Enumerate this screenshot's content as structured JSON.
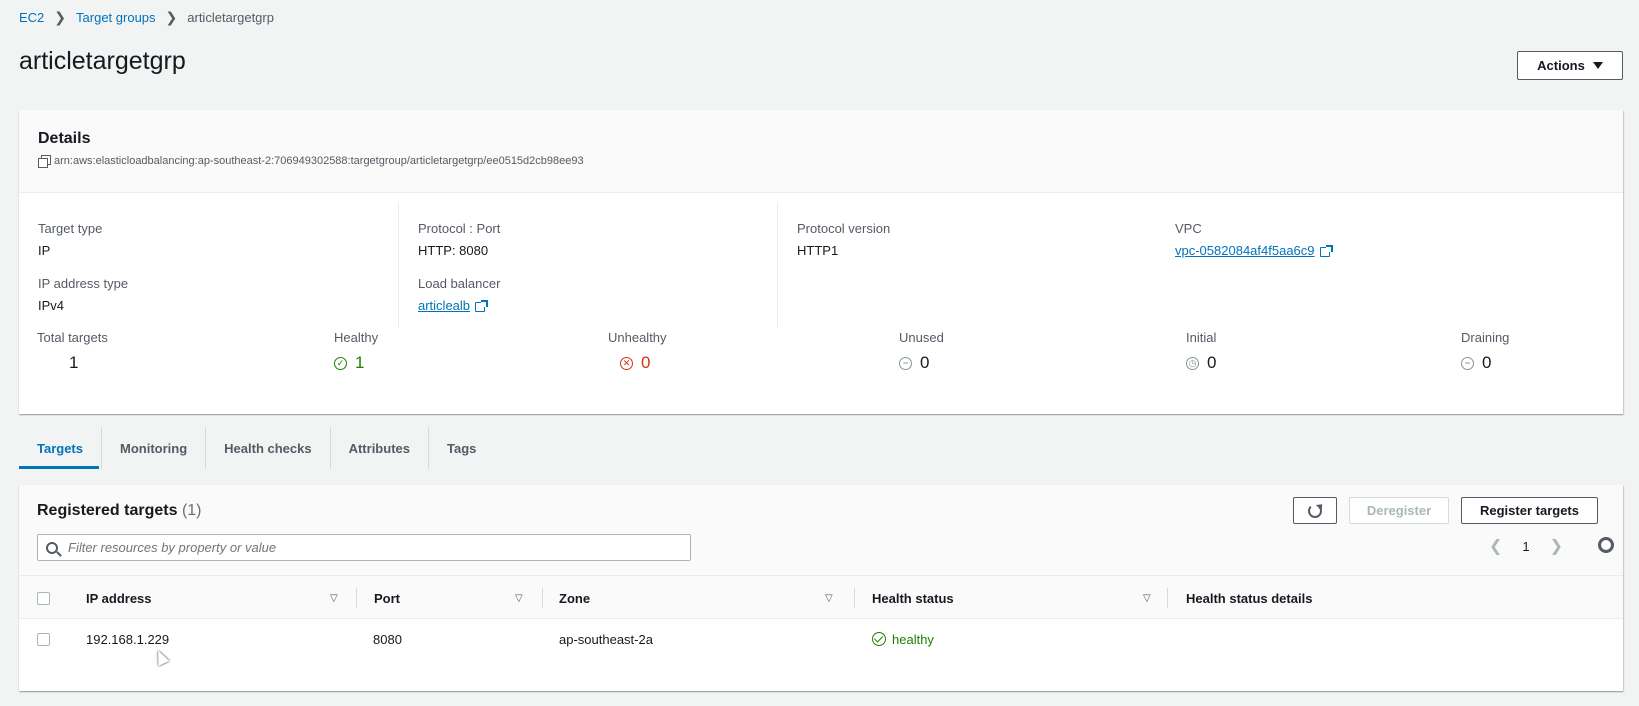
{
  "breadcrumb": {
    "root": "EC2",
    "parent": "Target groups",
    "current": "articletargetgrp"
  },
  "page": {
    "title": "articletargetgrp",
    "actions_label": "Actions"
  },
  "details": {
    "heading": "Details",
    "arn": "arn:aws:elasticloadbalancing:ap-southeast-2:706949302588:targetgroup/articletargetgrp/ee0515d2cb98ee93",
    "target_type_label": "Target type",
    "target_type": "IP",
    "ip_type_label": "IP address type",
    "ip_type": "IPv4",
    "protocol_port_label": "Protocol : Port",
    "protocol_port": "HTTP: 8080",
    "load_balancer_label": "Load balancer",
    "load_balancer": "articlealb",
    "protocol_version_label": "Protocol version",
    "protocol_version": "HTTP1",
    "vpc_label": "VPC",
    "vpc": "vpc-0582084af4f5aa6c9"
  },
  "counts": {
    "total_label": "Total targets",
    "total": "1",
    "healthy_label": "Healthy",
    "healthy": "1",
    "unhealthy_label": "Unhealthy",
    "unhealthy": "0",
    "unused_label": "Unused",
    "unused": "0",
    "initial_label": "Initial",
    "initial": "0",
    "draining_label": "Draining",
    "draining": "0"
  },
  "tabs": [
    {
      "label": "Targets"
    },
    {
      "label": "Monitoring"
    },
    {
      "label": "Health checks"
    },
    {
      "label": "Attributes"
    },
    {
      "label": "Tags"
    }
  ],
  "targets": {
    "title": "Registered targets",
    "count": "(1)",
    "deregister_label": "Deregister",
    "register_label": "Register targets",
    "filter_placeholder": "Filter resources by property or value",
    "page_number": "1",
    "columns": [
      "IP address",
      "Port",
      "Zone",
      "Health status",
      "Health status details"
    ],
    "rows": [
      {
        "ip": "192.168.1.229",
        "port": "8080",
        "zone": "ap-southeast-2a",
        "health": "healthy",
        "details": ""
      }
    ]
  },
  "colors": {
    "link": "#0073bb",
    "healthy": "#1d8102",
    "unhealthy": "#d13212",
    "neutral": "#879596"
  }
}
